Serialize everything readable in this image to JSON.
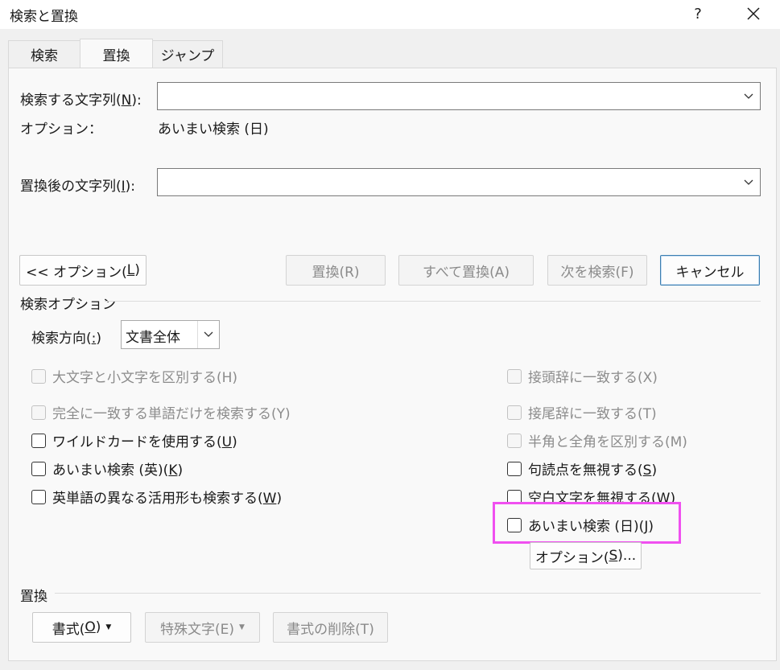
{
  "window": {
    "title": "検索と置換",
    "help_label": "?"
  },
  "tabs": [
    {
      "label": "検索",
      "active": false
    },
    {
      "label": "置換",
      "active": true
    },
    {
      "label": "ジャンプ",
      "active": false
    }
  ],
  "find": {
    "label_pre": "検索する文字列(",
    "label_key": "N",
    "label_post": "):",
    "value": "",
    "options_label": "オプション：",
    "options_value": "あいまい検索 (日)"
  },
  "replace": {
    "label_pre": "置換後の文字列(",
    "label_key": "I",
    "label_post": "):",
    "value": ""
  },
  "buttons": {
    "less_pre": "<< オプション(",
    "less_key": "L",
    "less_post": ")",
    "replace": "置換(R)",
    "replace_all": "すべて置換(A)",
    "find_next": "次を検索(F)",
    "cancel": "キャンセル"
  },
  "search_options": {
    "heading": "検索オプション",
    "direction_pre": "検索方向(",
    "direction_key": ":",
    "direction_post": ")",
    "direction_value": "文書全体"
  },
  "checkboxes_left": [
    {
      "label": "大文字と小文字を区別する(H)",
      "enabled": false,
      "checked": false
    },
    {
      "label": "完全に一致する単語だけを検索する(Y)",
      "enabled": false,
      "checked": false
    },
    {
      "pre": "ワイルドカードを使用する(",
      "key": "U",
      "post": ")",
      "enabled": true,
      "checked": false
    },
    {
      "pre": "あいまい検索 (英)(",
      "key": "K",
      "post": ")",
      "enabled": true,
      "checked": false
    },
    {
      "pre": "英単語の異なる活用形も検索する(",
      "key": "W",
      "post": ")",
      "enabled": true,
      "checked": false
    }
  ],
  "checkboxes_right": [
    {
      "label": "接頭辞に一致する(X)",
      "enabled": false,
      "checked": false
    },
    {
      "label": "接尾辞に一致する(T)",
      "enabled": false,
      "checked": false
    },
    {
      "label": "半角と全角を区別する(M)",
      "enabled": false,
      "checked": false
    },
    {
      "pre": "句読点を無視する(",
      "key": "S",
      "post": ")",
      "enabled": true,
      "checked": false
    },
    {
      "pre": "空白文字を無視する(",
      "key": "W",
      "post": ")",
      "enabled": true,
      "checked": false
    },
    {
      "pre": "あいまい検索 (日)(",
      "key": "J",
      "post": ")",
      "enabled": true,
      "checked": false
    }
  ],
  "options_button": {
    "pre": "オプション(",
    "key": "S",
    "post": ")..."
  },
  "replace_section": {
    "heading": "置換",
    "format_pre": "書式(",
    "format_key": "O",
    "format_post": ")",
    "special": "特殊文字(E)",
    "no_format": "書式の削除(T)"
  },
  "colors": {
    "highlight": "#f050f0",
    "default_button_border": "#3c7fb1"
  }
}
